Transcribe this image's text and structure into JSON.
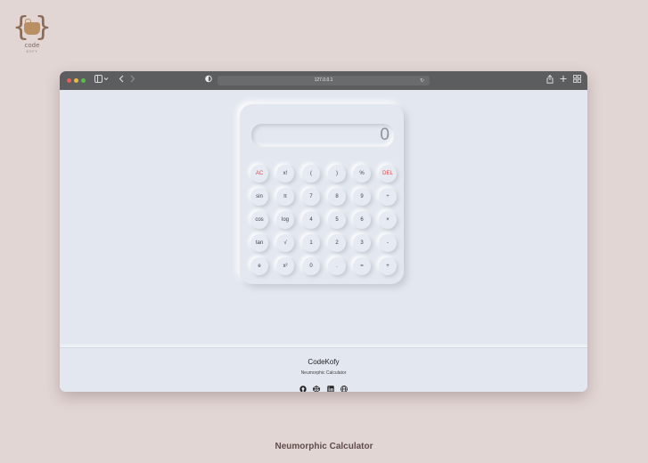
{
  "logo": {
    "word": "code",
    "sub": "KOFY"
  },
  "browser": {
    "url": "127.0.0.1",
    "icons": {
      "sidebar": "sidebar-icon",
      "back": "chevron-left-icon",
      "forward": "chevron-right-icon",
      "shield": "privacy-shield-icon",
      "reload": "reload-icon",
      "share": "share-icon",
      "new_tab": "plus-icon",
      "tabs": "tab-overview-icon"
    }
  },
  "calculator": {
    "display": "0",
    "keys": [
      {
        "label": "AC",
        "color": "#e04848"
      },
      {
        "label": "x!"
      },
      {
        "label": "("
      },
      {
        "label": ")"
      },
      {
        "label": "%"
      },
      {
        "label": "DEL",
        "color": "#e04848"
      },
      {
        "label": "sin"
      },
      {
        "label": "π"
      },
      {
        "label": "7"
      },
      {
        "label": "8"
      },
      {
        "label": "9"
      },
      {
        "label": "÷"
      },
      {
        "label": "cos"
      },
      {
        "label": "log"
      },
      {
        "label": "4"
      },
      {
        "label": "5"
      },
      {
        "label": "6"
      },
      {
        "label": "×"
      },
      {
        "label": "tan"
      },
      {
        "label": "√"
      },
      {
        "label": "1"
      },
      {
        "label": "2"
      },
      {
        "label": "3"
      },
      {
        "label": "-"
      },
      {
        "label": "e"
      },
      {
        "label": "x²"
      },
      {
        "label": "0"
      },
      {
        "label": "."
      },
      {
        "label": "="
      },
      {
        "label": "+"
      }
    ]
  },
  "footer": {
    "title": "CodeKofy",
    "subtitle": "Neumorphic Calculator",
    "social_icons": [
      "github-icon",
      "codepen-icon",
      "linkedin-icon",
      "globe-icon"
    ]
  },
  "caption": "Neumorphic Calculator"
}
